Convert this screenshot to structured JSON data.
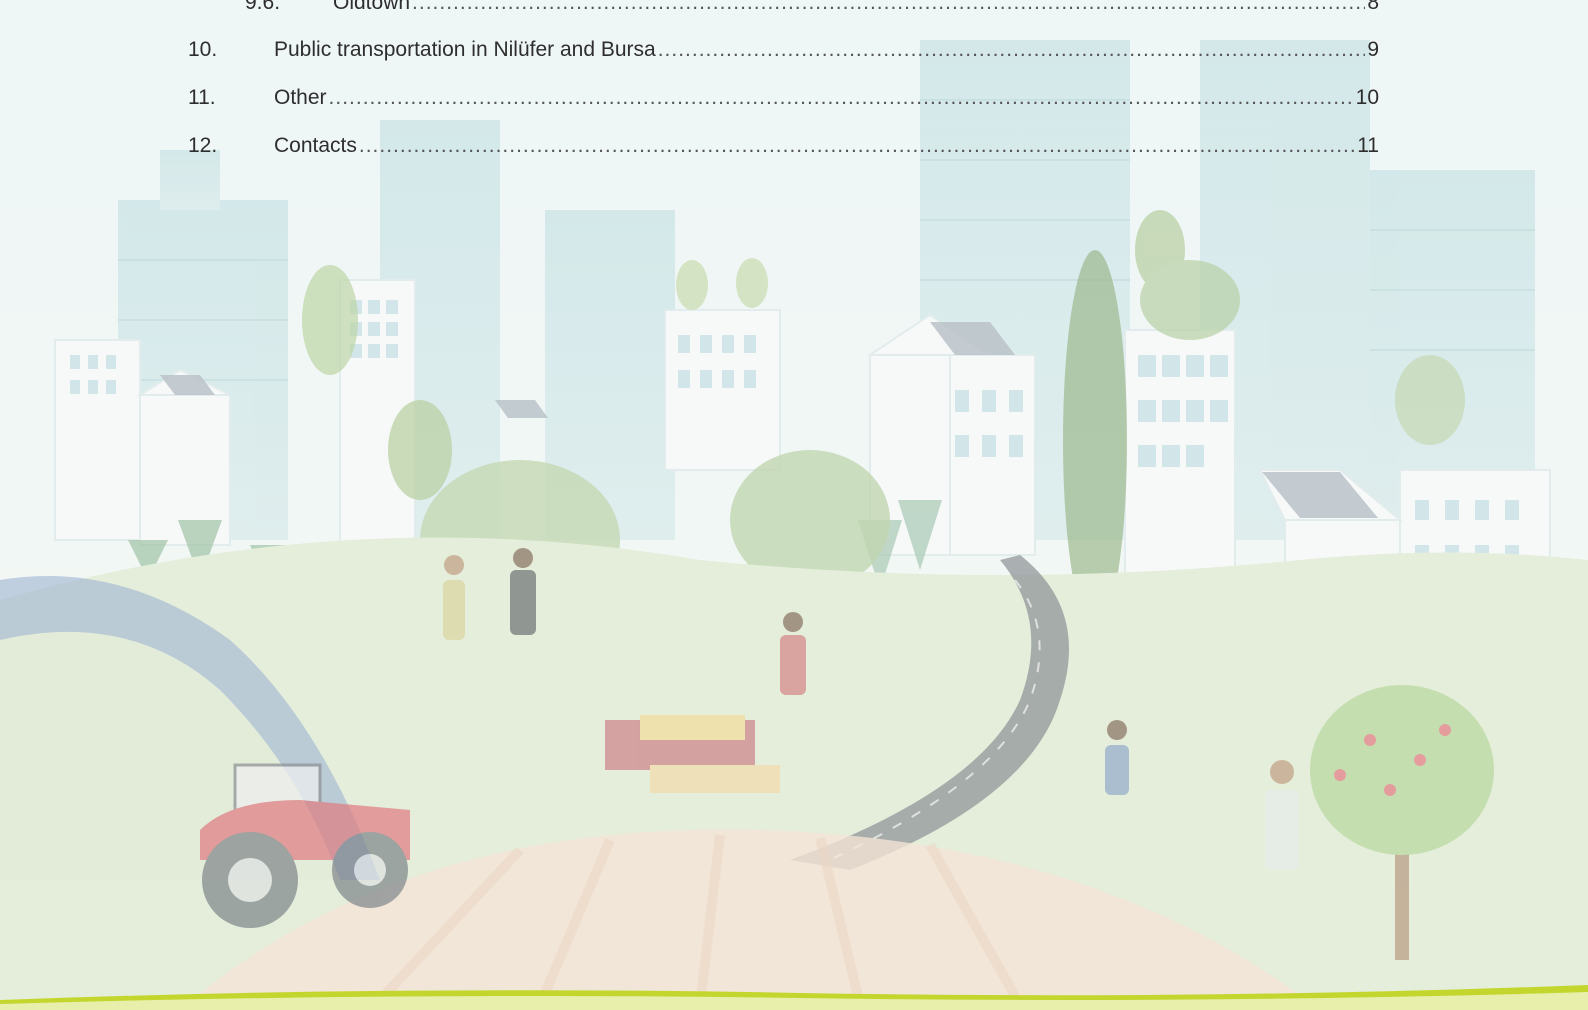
{
  "toc": [
    {
      "number": "9.6.",
      "title": "Oldtown",
      "page": "8",
      "level": 2
    },
    {
      "number": "10.",
      "title": "Public transportation in Nilüfer and Bursa",
      "page": "9",
      "level": 1
    },
    {
      "number": "11.",
      "title": "Other",
      "page": "10",
      "level": 1
    },
    {
      "number": "12.",
      "title": "Contacts",
      "page": "11",
      "level": 1
    }
  ],
  "colors": {
    "text": "#2e2e2e",
    "footer_wave": "#c3d62e",
    "background": "#f3f8f7"
  }
}
